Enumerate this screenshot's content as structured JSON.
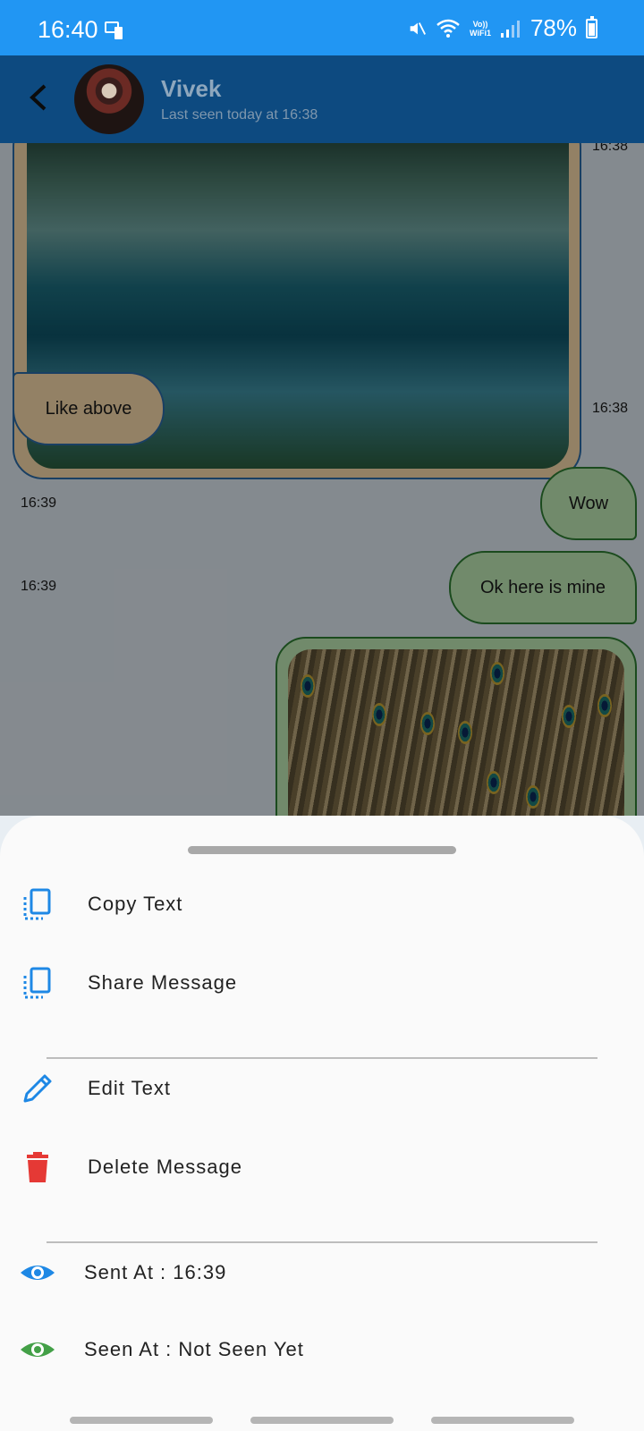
{
  "status_bar": {
    "time": "16:40",
    "wifi_label_top": "Vo))",
    "wifi_label_bottom": "WiFi1",
    "battery": "78%"
  },
  "header": {
    "contact_name": "Vivek",
    "last_seen": "Last seen today at 16:38"
  },
  "chat": {
    "messages": [
      {
        "type": "image",
        "time": "16:38",
        "sender": "contact"
      },
      {
        "type": "text",
        "text": "Like above",
        "time": "16:38",
        "sender": "contact"
      },
      {
        "type": "text",
        "text": "Wow",
        "time": "16:39",
        "sender": "me"
      },
      {
        "type": "text",
        "text": "Ok here is mine",
        "time": "16:39",
        "sender": "me"
      },
      {
        "type": "image",
        "sender": "me"
      }
    ]
  },
  "sheet": {
    "items": [
      {
        "label": "Copy Text",
        "icon": "copy-icon",
        "color": "#1e88e5"
      },
      {
        "label": "Share Message",
        "icon": "copy-icon",
        "color": "#1e88e5"
      },
      {
        "label": "Edit Text",
        "icon": "pencil-icon",
        "color": "#1e88e5"
      },
      {
        "label": "Delete Message",
        "icon": "trash-icon",
        "color": "#e53935"
      },
      {
        "label": "Sent At : 16:39",
        "icon": "eye-icon",
        "color": "#1e88e5"
      },
      {
        "label": "Seen At : Not Seen Yet",
        "icon": "eye-icon",
        "color": "#43a047"
      }
    ]
  },
  "colors": {
    "status_bar": "#2196f3",
    "app_bar": "#0d4a80",
    "incoming_bubble": "#f5d8a8",
    "outgoing_bubble": "#bde6b3"
  }
}
